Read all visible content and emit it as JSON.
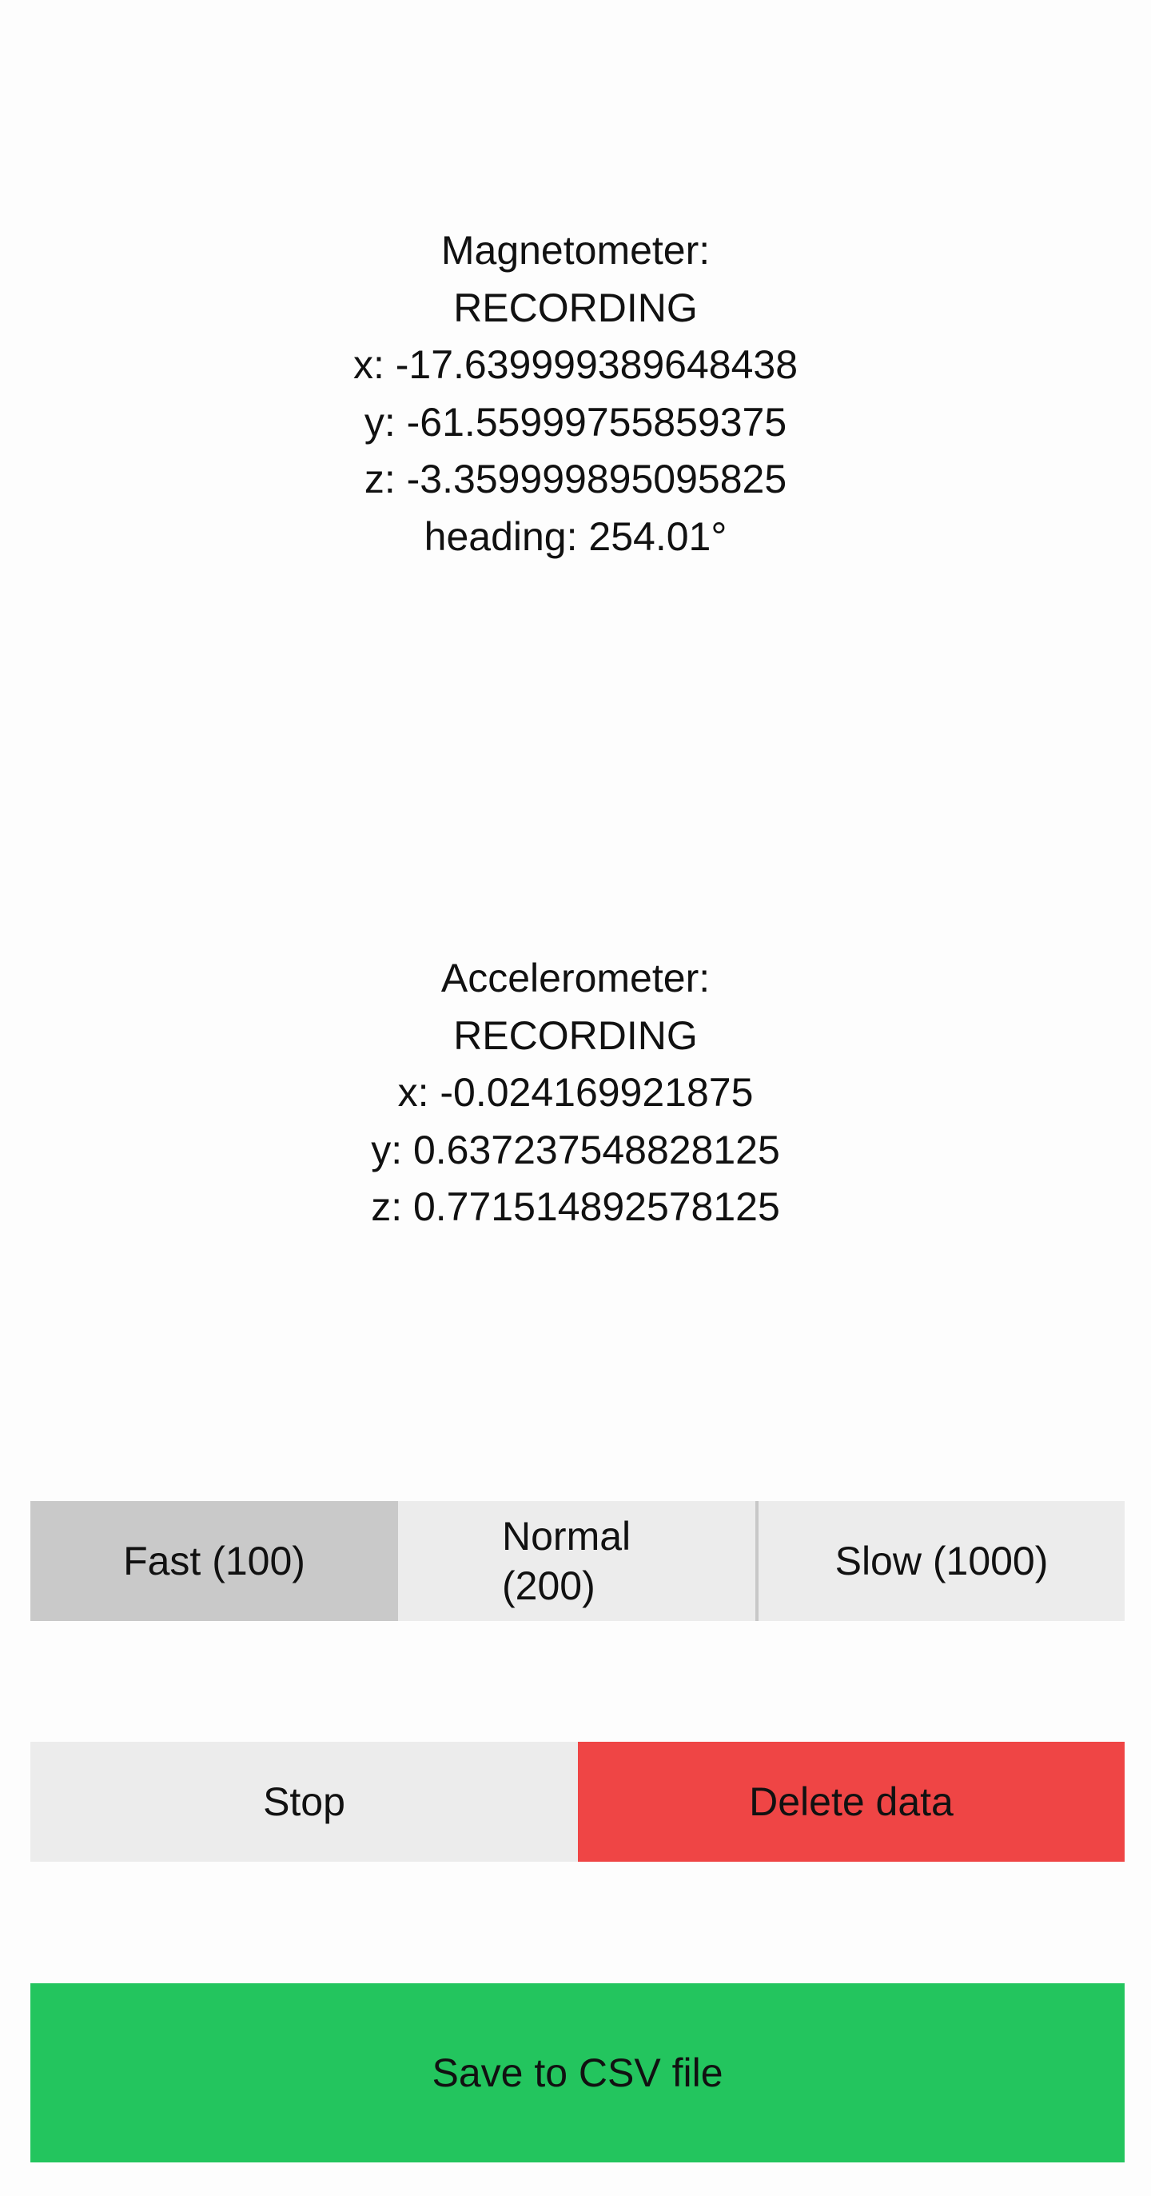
{
  "magnetometer": {
    "title": "Magnetometer:",
    "status": "RECORDING",
    "x": "x: -17.639999389648438",
    "y": "y: -61.55999755859375",
    "z": "z: -3.359999895095825",
    "heading": "heading: 254.01°"
  },
  "accelerometer": {
    "title": "Accelerometer:",
    "status": "RECORDING",
    "x": "x: -0.024169921875",
    "y": "y: 0.637237548828125",
    "z": "z: 0.771514892578125"
  },
  "rate_selector": {
    "selected": "Fast (100)",
    "options": {
      "fast": "Fast (100)",
      "normal_line1": "Normal",
      "normal_line2": "(200)",
      "slow": "Slow (1000)"
    }
  },
  "controls": {
    "stop_label": "Stop",
    "delete_label": "Delete data",
    "save_label": "Save to CSV file"
  },
  "colors": {
    "selected_rate_bg": "#c9c9c9",
    "button_bg": "#ececec",
    "delete_bg": "#ef4545",
    "save_bg": "#23c55e"
  }
}
